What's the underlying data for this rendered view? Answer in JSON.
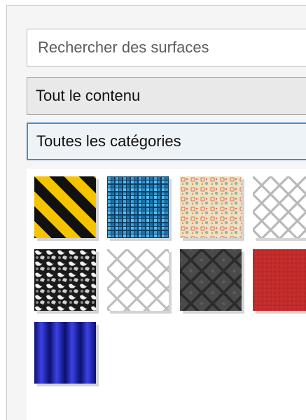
{
  "search": {
    "placeholder": "Rechercher des surfaces"
  },
  "filters": {
    "content_label": "Tout le contenu",
    "category_label": "Toutes les catégories"
  },
  "surfaces": [
    {
      "name": "yellow-black-hazard-stripes"
    },
    {
      "name": "blue-mosaic-tiles"
    },
    {
      "name": "beige-floral-pattern"
    },
    {
      "name": "chain-link-fence-white"
    },
    {
      "name": "black-white-camouflage"
    },
    {
      "name": "chain-link-fence-light"
    },
    {
      "name": "dark-metal-plate"
    },
    {
      "name": "red-leather"
    },
    {
      "name": "blue-corrugated-metal"
    }
  ],
  "colors": {
    "accent": "#3d8fd9",
    "hazard_yellow": "#f5c400",
    "mosaic_blue": "#2c8fc8",
    "leather_red": "#c32b2b",
    "corrugated_blue": "#2a2fb8"
  }
}
